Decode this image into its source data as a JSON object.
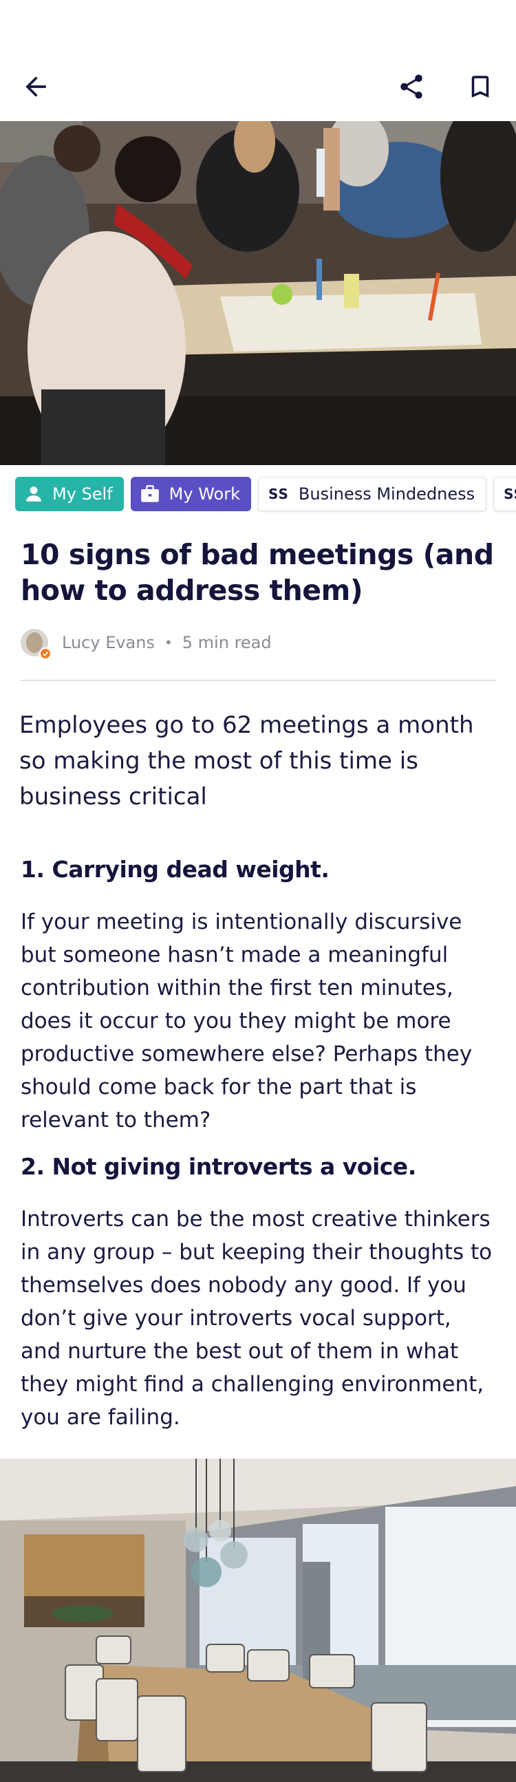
{
  "header": {
    "back_icon": "arrow-left-icon",
    "share_icon": "share-icon",
    "bookmark_icon": "bookmark-icon"
  },
  "hero_image": {
    "subject": "people-collaborating-at-table"
  },
  "tags": [
    {
      "label": "My Self",
      "icon": "person-icon",
      "color": "#26b3a8"
    },
    {
      "label": "My Work",
      "icon": "briefcase-icon",
      "color": "#5a4fc4"
    },
    {
      "prefix": "SS",
      "label": "Business Mindedness"
    },
    {
      "prefix": "SS",
      "label": ""
    }
  ],
  "article": {
    "title": "10 signs of bad meetings (and how to address them)",
    "author": "Lucy Evans",
    "separator": "•",
    "read_time": "5 min read",
    "lede": "Employees go to 62 meetings a month so making the most of this time is business critical",
    "sections": [
      {
        "heading": "1. Carrying dead weight.",
        "body": "If your meeting is intentionally discursive but someone hasn’t made a meaningful contribution within the first ten minutes, does it occur to you they might be more productive somewhere else? Perhaps they should come back for the part that is relevant to them?"
      },
      {
        "heading": "2. Not giving introverts a voice.",
        "body": "Introverts can be the most creative thinkers in any group – but keeping their thoughts to themselves does nobody any good. If you don’t give your introverts vocal support, and nurture the best out of them in what they might find a challenging environment, you are failing."
      }
    ]
  },
  "second_image": {
    "subject": "conference-room"
  },
  "colors": {
    "text": "#14143c",
    "muted": "#8a8a98",
    "accent_teal": "#26b3a8",
    "accent_purple": "#5a4fc4",
    "badge_orange": "#f07c2a"
  }
}
